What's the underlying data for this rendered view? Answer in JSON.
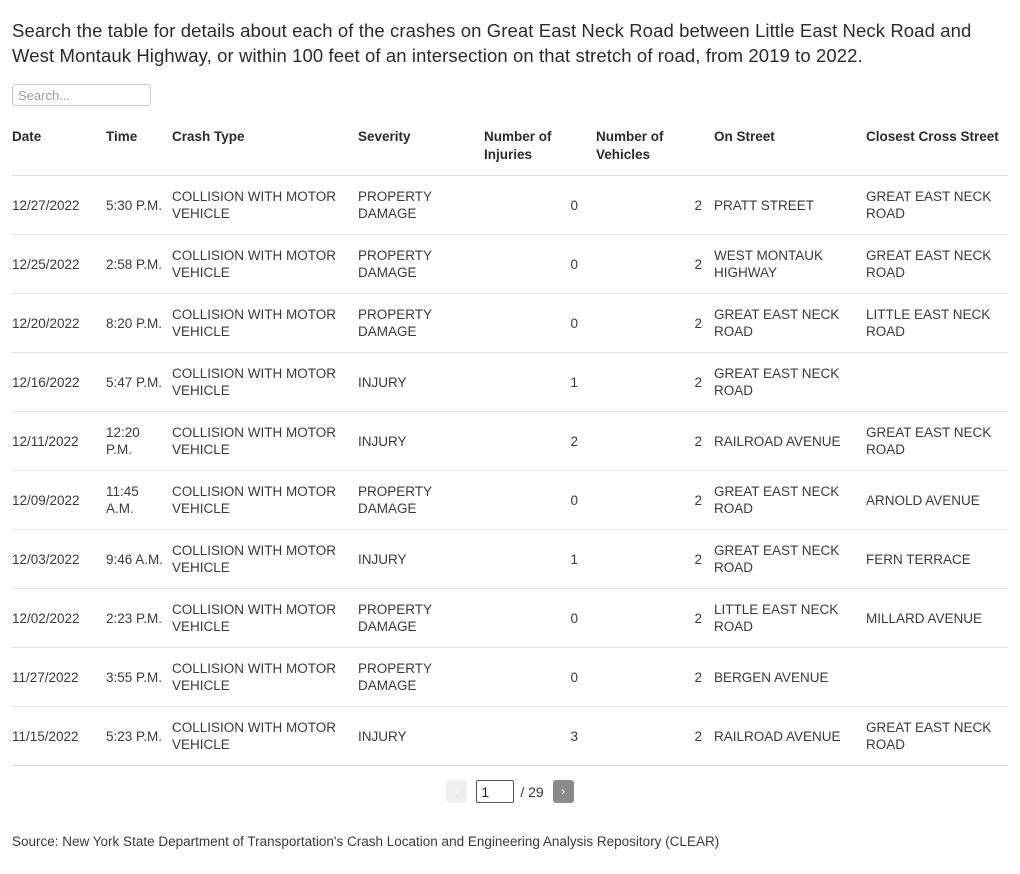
{
  "intro": {
    "text": "Search the table for details about each of the crashes on Great East Neck Road between Little East Neck Road and West Montauk Highway, or within 100 feet of an intersection on that stretch of road, from 2019 to 2022."
  },
  "search": {
    "placeholder": "Search...",
    "value": ""
  },
  "table": {
    "columns": [
      {
        "key": "date",
        "label": "Date"
      },
      {
        "key": "time",
        "label": "Time"
      },
      {
        "key": "type",
        "label": "Crash Type"
      },
      {
        "key": "sev",
        "label": "Severity"
      },
      {
        "key": "inj",
        "label": "Number of Injuries"
      },
      {
        "key": "veh",
        "label": "Number of Vehicles"
      },
      {
        "key": "on",
        "label": "On Street"
      },
      {
        "key": "cross",
        "label": "Closest Cross Street"
      }
    ],
    "headers": {
      "date": "Date",
      "time": "Time",
      "type": "Crash Type",
      "sev": "Severity",
      "inj": "Number of Injuries",
      "veh": "Number of Vehicles",
      "on": "On Street",
      "cross": "Closest Cross Street"
    },
    "rows": [
      {
        "date": "12/27/2022",
        "time": "5:30 P.M.",
        "type": "COLLISION WITH MOTOR VEHICLE",
        "sev": "PROPERTY DAMAGE",
        "inj": "0",
        "veh": "2",
        "on": "PRATT STREET",
        "cross": "GREAT EAST NECK ROAD"
      },
      {
        "date": "12/25/2022",
        "time": "2:58 P.M.",
        "type": "COLLISION WITH MOTOR VEHICLE",
        "sev": "PROPERTY DAMAGE",
        "inj": "0",
        "veh": "2",
        "on": "WEST MONTAUK HIGHWAY",
        "cross": "GREAT EAST NECK ROAD"
      },
      {
        "date": "12/20/2022",
        "time": "8:20 P.M.",
        "type": "COLLISION WITH MOTOR VEHICLE",
        "sev": "PROPERTY DAMAGE",
        "inj": "0",
        "veh": "2",
        "on": "GREAT EAST NECK ROAD",
        "cross": "LITTLE EAST NECK ROAD"
      },
      {
        "date": "12/16/2022",
        "time": "5:47 P.M.",
        "type": "COLLISION WITH MOTOR VEHICLE",
        "sev": "INJURY",
        "inj": "1",
        "veh": "2",
        "on": "GREAT EAST NECK ROAD",
        "cross": ""
      },
      {
        "date": "12/11/2022",
        "time": "12:20 P.M.",
        "type": "COLLISION WITH MOTOR VEHICLE",
        "sev": "INJURY",
        "inj": "2",
        "veh": "2",
        "on": "RAILROAD AVENUE",
        "cross": "GREAT EAST NECK ROAD"
      },
      {
        "date": "12/09/2022",
        "time": "11:45 A.M.",
        "type": "COLLISION WITH MOTOR VEHICLE",
        "sev": "PROPERTY DAMAGE",
        "inj": "0",
        "veh": "2",
        "on": "GREAT EAST NECK ROAD",
        "cross": "ARNOLD AVENUE"
      },
      {
        "date": "12/03/2022",
        "time": "9:46 A.M.",
        "type": "COLLISION WITH MOTOR VEHICLE",
        "sev": "INJURY",
        "inj": "1",
        "veh": "2",
        "on": "GREAT EAST NECK ROAD",
        "cross": "FERN TERRACE"
      },
      {
        "date": "12/02/2022",
        "time": "2:23 P.M.",
        "type": "COLLISION WITH MOTOR VEHICLE",
        "sev": "PROPERTY DAMAGE",
        "inj": "0",
        "veh": "2",
        "on": "LITTLE EAST NECK ROAD",
        "cross": "MILLARD AVENUE"
      },
      {
        "date": "11/27/2022",
        "time": "3:55 P.M.",
        "type": "COLLISION WITH MOTOR VEHICLE",
        "sev": "PROPERTY DAMAGE",
        "inj": "0",
        "veh": "2",
        "on": "BERGEN AVENUE",
        "cross": ""
      },
      {
        "date": "11/15/2022",
        "time": "5:23 P.M.",
        "type": "COLLISION WITH MOTOR VEHICLE",
        "sev": "INJURY",
        "inj": "3",
        "veh": "2",
        "on": "RAILROAD AVENUE",
        "cross": "GREAT EAST NECK ROAD"
      }
    ]
  },
  "pagination": {
    "prev_label": "‹",
    "next_label": "›",
    "current_page": "1",
    "total_label": "/ 29",
    "total_pages": 29
  },
  "source": {
    "text": "Source: New York State Department of Transportation's Crash Location and Engineering Analysis Repository (CLEAR)"
  },
  "colors": {
    "text": "#333333",
    "row_border": "#e4e4e4",
    "header_border": "#dddddd",
    "next_button_bg": "#8a8a8a",
    "prev_button_bg": "#efefef"
  }
}
